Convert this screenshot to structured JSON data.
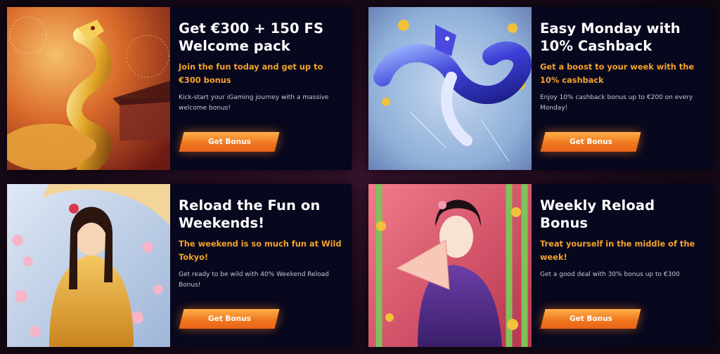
{
  "promos": [
    {
      "title": "Get €300 + 150 FS Welcome pack",
      "subtitle": "Join the fun today and get up to €300 bonus",
      "description": "Kick-start your iGaming journey with a massive welcome bonus!",
      "button_label": "Get Bonus",
      "image": "golden-dragon-image"
    },
    {
      "title": "Easy Monday with 10% Cashback",
      "subtitle": "Get a boost to your week with the 10% cashback",
      "description": "Enjoy 10% cashback bonus up to €200 on every Monday!",
      "button_label": "Get Bonus",
      "image": "blue-dragon-image"
    },
    {
      "title": "Reload the Fun on Weekends!",
      "subtitle": "The weekend is so much fun at Wild Tokyo!",
      "description": "Get ready to be wild with 40% Weekend Reload Bonus!",
      "button_label": "Get Bonus",
      "image": "umbrella-woman-image"
    },
    {
      "title": "Weekly Reload Bonus",
      "subtitle": "Treat yourself in the middle of the week!",
      "description": "Get a good deal with 30% bonus up to €300",
      "button_label": "Get Bonus",
      "image": "geisha-fan-image"
    }
  ],
  "colors": {
    "card_bg": "#07071d",
    "accent_orange": "#f4a22a",
    "button_orange": "#f0781e",
    "title_white": "#ffffff"
  }
}
